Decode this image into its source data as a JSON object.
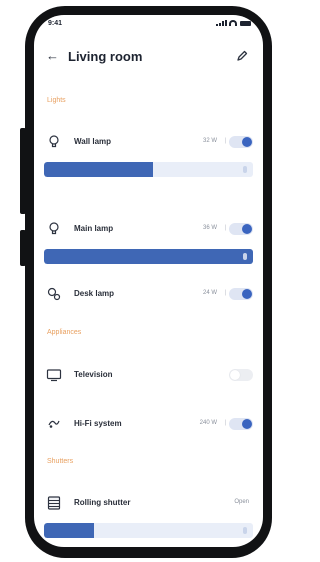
{
  "status_bar": {
    "time": "9:41"
  },
  "header": {
    "title": "Living room"
  },
  "sections": {
    "lights": "Lights",
    "appliances": "Appliances",
    "shutters": "Shutters"
  },
  "lights": [
    {
      "label": "Wall lamp",
      "value": "32 W",
      "on": true,
      "level_percent": 52,
      "icon": "bulb-icon"
    },
    {
      "label": "Main lamp",
      "value": "36 W",
      "on": true,
      "level_percent": 100,
      "icon": "bulb-icon"
    },
    {
      "label": "Desk lamp",
      "value": "24 W",
      "on": true,
      "icon": "desk-lamp-icon"
    }
  ],
  "appliances": [
    {
      "label": "Television",
      "on": false,
      "icon": "tv-icon"
    },
    {
      "label": "Hi-Fi system",
      "value": "240 W",
      "on": true,
      "icon": "speaker-icon"
    }
  ],
  "shutters": [
    {
      "label": "Rolling shutter",
      "state": "Open",
      "level_percent": 24,
      "icon": "shutter-icon"
    }
  ],
  "colors": {
    "accent": "#3f67b5",
    "section_label": "#e8a060",
    "track": "#e9eef8"
  }
}
